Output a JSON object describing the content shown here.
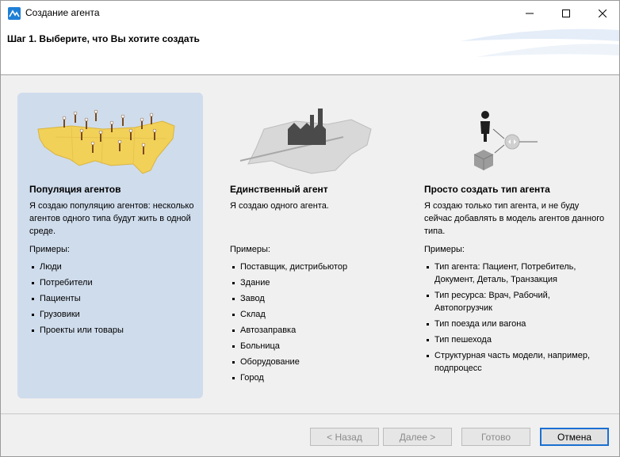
{
  "window": {
    "title": "Создание агента",
    "controls": {
      "minimize": "minimize-icon",
      "maximize": "maximize-icon",
      "close": "close-icon"
    }
  },
  "header": {
    "step_title": "Шаг 1. Выберите, что Вы хотите создать"
  },
  "options": [
    {
      "title": "Популяция агентов",
      "description": "Я создаю популяцию агентов: несколько агентов одного типа будут жить в одной среде.",
      "examples_label": "Примеры:",
      "examples": [
        "Люди",
        "Потребители",
        "Пациенты",
        "Грузовики",
        "Проекты или товары"
      ],
      "selected": true,
      "image": "map-with-people-illustration"
    },
    {
      "title": "Единственный агент",
      "description": "Я создаю одного агента.",
      "examples_label": "Примеры:",
      "examples": [
        "Поставщик, дистрибьютор",
        "Здание",
        "Завод",
        "Склад",
        "Автозаправка",
        "Больница",
        "Оборудование",
        "Город"
      ],
      "selected": false,
      "image": "factory-on-map-illustration"
    },
    {
      "title": "Просто создать тип агента",
      "description": "Я создаю только тип агента, и не буду сейчас добавлять в модель агентов данного типа.",
      "examples_label": "Примеры:",
      "examples": [
        "Тип агента: Пациент, Потребитель, Документ, Деталь, Транзакция",
        "Тип ресурса: Врач, Рабочий, Автопогрузчик",
        "Тип поезда или вагона",
        "Тип пешехода",
        "Структурная часть модели, например, подпроцесс"
      ],
      "selected": false,
      "image": "agent-type-flow-illustration"
    }
  ],
  "footer": {
    "back_label": "< Назад",
    "next_label": "Далее >",
    "finish_label": "Готово",
    "cancel_label": "Отмена"
  },
  "colors": {
    "selected_panel": "#cfdcec",
    "map_fill": "#f2d158",
    "accent_border": "#1a6fd1"
  }
}
